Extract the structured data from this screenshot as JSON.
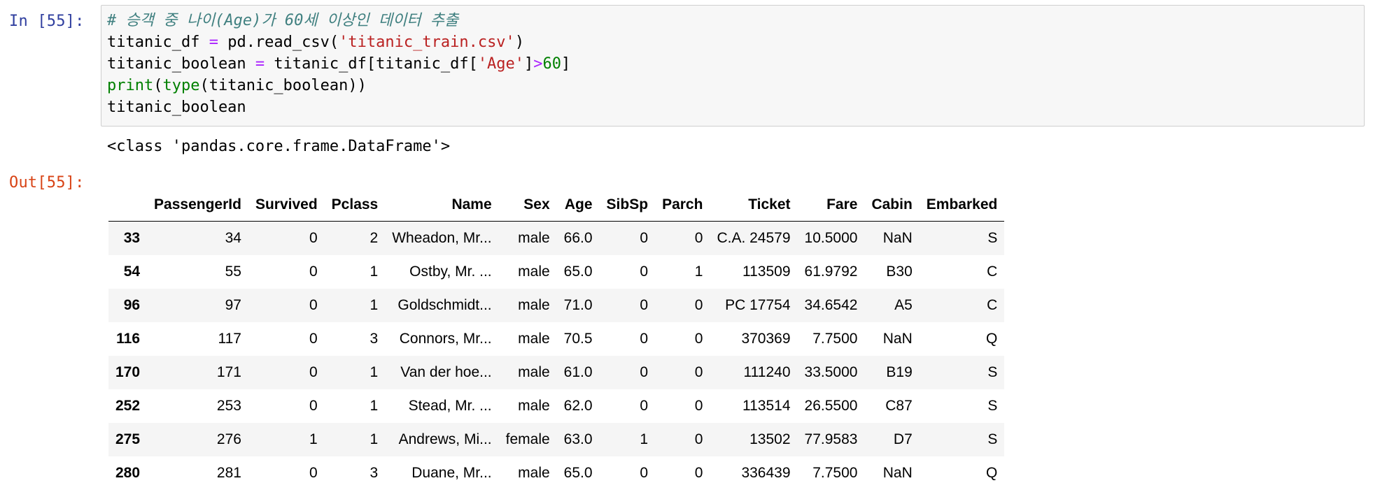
{
  "input_prompt": "In [55]:",
  "output_prompt": "Out[55]:",
  "code": {
    "comment": "# 승객 중 나이(Age)가 60세 이상인 데이터 추출",
    "line2": {
      "a": "titanic_df ",
      "op": "=",
      "b": " pd.read_csv(",
      "str": "'titanic_train.csv'",
      "c": ")"
    },
    "line3": {
      "a": "titanic_boolean ",
      "op": "=",
      "b": " titanic_df[titanic_df[",
      "str": "'Age'",
      "c": "]",
      "op2": ">",
      "num": "60",
      "d": "]"
    },
    "line4": {
      "builtin1": "print",
      "a": "(",
      "builtin2": "type",
      "b": "(titanic_boolean))"
    },
    "line5": "titanic_boolean"
  },
  "stdout": "<class 'pandas.core.frame.DataFrame'>",
  "table": {
    "columns": [
      "PassengerId",
      "Survived",
      "Pclass",
      "Name",
      "Sex",
      "Age",
      "SibSp",
      "Parch",
      "Ticket",
      "Fare",
      "Cabin",
      "Embarked"
    ],
    "rows": [
      {
        "index": "33",
        "values": [
          "34",
          "0",
          "2",
          "Wheadon, Mr...",
          "male",
          "66.0",
          "0",
          "0",
          "C.A. 24579",
          "10.5000",
          "NaN",
          "S"
        ]
      },
      {
        "index": "54",
        "values": [
          "55",
          "0",
          "1",
          "Ostby, Mr. ...",
          "male",
          "65.0",
          "0",
          "1",
          "113509",
          "61.9792",
          "B30",
          "C"
        ]
      },
      {
        "index": "96",
        "values": [
          "97",
          "0",
          "1",
          "Goldschmidt...",
          "male",
          "71.0",
          "0",
          "0",
          "PC 17754",
          "34.6542",
          "A5",
          "C"
        ]
      },
      {
        "index": "116",
        "values": [
          "117",
          "0",
          "3",
          "Connors, Mr...",
          "male",
          "70.5",
          "0",
          "0",
          "370369",
          "7.7500",
          "NaN",
          "Q"
        ]
      },
      {
        "index": "170",
        "values": [
          "171",
          "0",
          "1",
          "Van der hoe...",
          "male",
          "61.0",
          "0",
          "0",
          "111240",
          "33.5000",
          "B19",
          "S"
        ]
      },
      {
        "index": "252",
        "values": [
          "253",
          "0",
          "1",
          "Stead, Mr. ...",
          "male",
          "62.0",
          "0",
          "0",
          "113514",
          "26.5500",
          "C87",
          "S"
        ]
      },
      {
        "index": "275",
        "values": [
          "276",
          "1",
          "1",
          "Andrews, Mi...",
          "female",
          "63.0",
          "1",
          "0",
          "13502",
          "77.9583",
          "D7",
          "S"
        ]
      },
      {
        "index": "280",
        "values": [
          "281",
          "0",
          "3",
          "Duane, Mr...",
          "male",
          "65.0",
          "0",
          "0",
          "336439",
          "7.7500",
          "NaN",
          "Q"
        ]
      }
    ]
  }
}
